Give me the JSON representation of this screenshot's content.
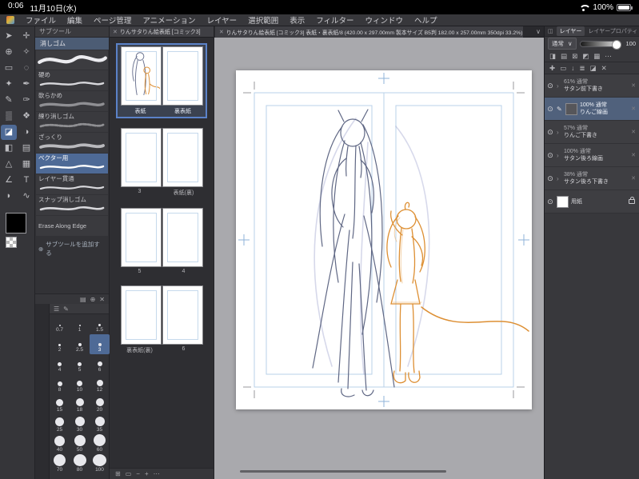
{
  "status_bar": {
    "time": "0:06",
    "date": "11月10日(水)",
    "battery_pct": "100%"
  },
  "menu_bar": {
    "items": [
      "ファイル",
      "編集",
      "ページ管理",
      "アニメーション",
      "レイヤー",
      "選択範囲",
      "表示",
      "フィルター",
      "ウィンドウ",
      "ヘルプ"
    ]
  },
  "icons": {
    "operation_tool": "➤",
    "move_tool": "✛",
    "zoom_tool": "⊕",
    "eyedropper_tool": "✧",
    "select_tool": "▭",
    "lasso_tool": "◌",
    "wand_tool": "✦",
    "pen_tool": "✒",
    "pencil_tool": "✎",
    "brush_tool": "✑",
    "airbrush_tool": "▒",
    "decoration_tool": "❖",
    "eraser_tool": "◪",
    "blend_tool": "◑",
    "fill_tool": "◧",
    "gradient_tool": "▤",
    "figure_tool": "△",
    "frame_tool": "▦",
    "ruler_tool": "∠",
    "text_tool": "T",
    "balloon_tool": "◗",
    "correct_tool": "∿",
    "close": "✕",
    "dropdown": "∨",
    "chevron_right": "›",
    "eye": "⊙",
    "plus": "✚",
    "menu": "☰",
    "pencil": "✎",
    "subtool_menu": "▤",
    "subtool_add": "⊕",
    "subtool_delete": "✕",
    "brush_menu": "☰",
    "brush_edit": "✎",
    "page_grid": "⊞",
    "page_spread": "▭",
    "page_zoom_out": "−",
    "page_zoom_in": "+",
    "page_more": "⋯",
    "lp_thumb": "◫",
    "lp_clip": "◨",
    "lp_lock_alpha": "▤",
    "lp_lock": "⊠",
    "lp_mask": "◩",
    "lp_ruler": "▦",
    "lp_more": "⋯",
    "lp_new": "✚",
    "lp_folder": "▭",
    "lp_down": "↓",
    "lp_merge": "≣",
    "lp_mask2": "◪",
    "lp_delete": "✕",
    "row_x": "✕"
  },
  "subtool_panel": {
    "title": "サブツール",
    "group_tab": "消しゴム",
    "items": [
      "硬め",
      "軟らかめ",
      "練り消しゴム",
      "ざっくり",
      "ベクター用",
      "レイヤー貫通",
      "スナップ消しゴム",
      "Erase Along Edge"
    ],
    "selected_item": "ベクター用",
    "add_label": "サブツールを追加する"
  },
  "brush_size_panel": {
    "values": [
      "0.7",
      "1",
      "1.5",
      "2",
      "2.5",
      "3",
      "4",
      "5",
      "6",
      "8",
      "10",
      "12",
      "15",
      "18",
      "20",
      "25",
      "30",
      "35",
      "40",
      "50",
      "60",
      "70",
      "80",
      "100"
    ],
    "selected": "3"
  },
  "page_panel": {
    "tab_title": "りんサタりん絵表紙 [コミック3]",
    "spreads": [
      {
        "left_label": "表紙",
        "right_label": "裏表紙"
      },
      {
        "left_label": "3",
        "right_label": "表紙(裏)"
      },
      {
        "left_label": "5",
        "right_label": "4"
      },
      {
        "left_label": "裏表紙(裏)",
        "right_label": "6"
      }
    ]
  },
  "canvas": {
    "tab_title": "りんサタりん絵表紙 [コミック3] 表紙・裏表紙/8 (420.00 x 297.00mm 製本サイズ B5判 182.00 x 257.00mm 350dpi 33.2%)"
  },
  "layer_panel": {
    "tabs": [
      "レイヤー",
      "レイヤープロパティ"
    ],
    "blend_mode": "通常",
    "opacity_value": "100",
    "layers": [
      {
        "info": "61% 通常",
        "name": "サタン前下書き"
      },
      {
        "info": "100% 通常",
        "name": "りんご線画"
      },
      {
        "info": "57% 通常",
        "name": "りんご下書き"
      },
      {
        "info": "100% 通常",
        "name": "サタン後ろ線画"
      },
      {
        "info": "38% 通常",
        "name": "サタン後ろ下書き"
      },
      {
        "info": "",
        "name": "用紙"
      }
    ]
  },
  "colors": {
    "selection_blue": "#4e6a96",
    "canvas_bg": "#a9a9ad",
    "sketch_gray": "#5f6784",
    "sketch_orange": "#dd8f33",
    "guide_blue": "#b9d1e8"
  }
}
